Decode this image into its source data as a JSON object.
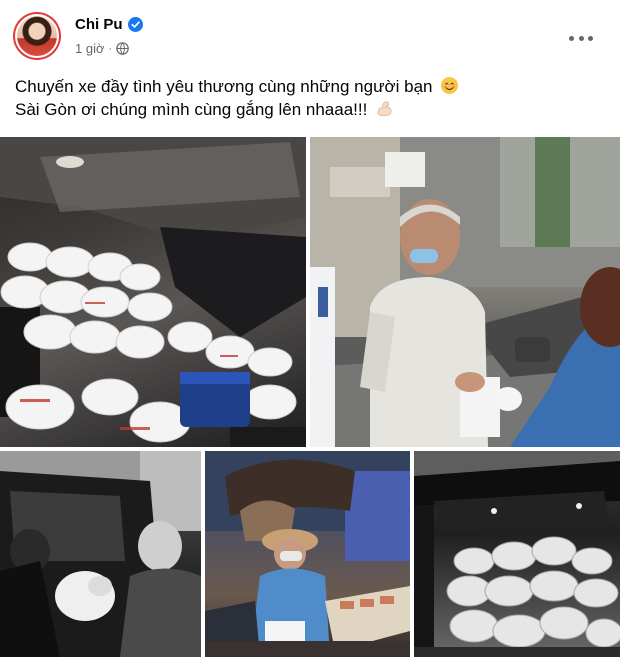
{
  "post": {
    "author": "Chi Pu",
    "verified": true,
    "time": "1 giờ",
    "separator": "·",
    "audience_icon": "globe-icon",
    "more_icon": "more-horizontal-icon",
    "caption_line1": "Chuyến xe đầy tình yêu thương cùng những người bạn",
    "caption_line1_emoji": "smiling-face-emoji",
    "caption_line2": "Sài Gòn ơi chúng mình cùng gắng lên nhaaa!!!",
    "caption_line2_emoji": "flexed-biceps-emoji",
    "photos": [
      {
        "name": "photo-van-interior-bags"
      },
      {
        "name": "photo-elderly-man-receiving-bag"
      },
      {
        "name": "photo-bw-handing-bag"
      },
      {
        "name": "photo-street-vendor-night"
      },
      {
        "name": "photo-bw-van-bags"
      }
    ]
  },
  "colors": {
    "verified_blue": "#1877f2",
    "meta_gray": "#65676b",
    "avatar_ring": "#e23a3a"
  }
}
